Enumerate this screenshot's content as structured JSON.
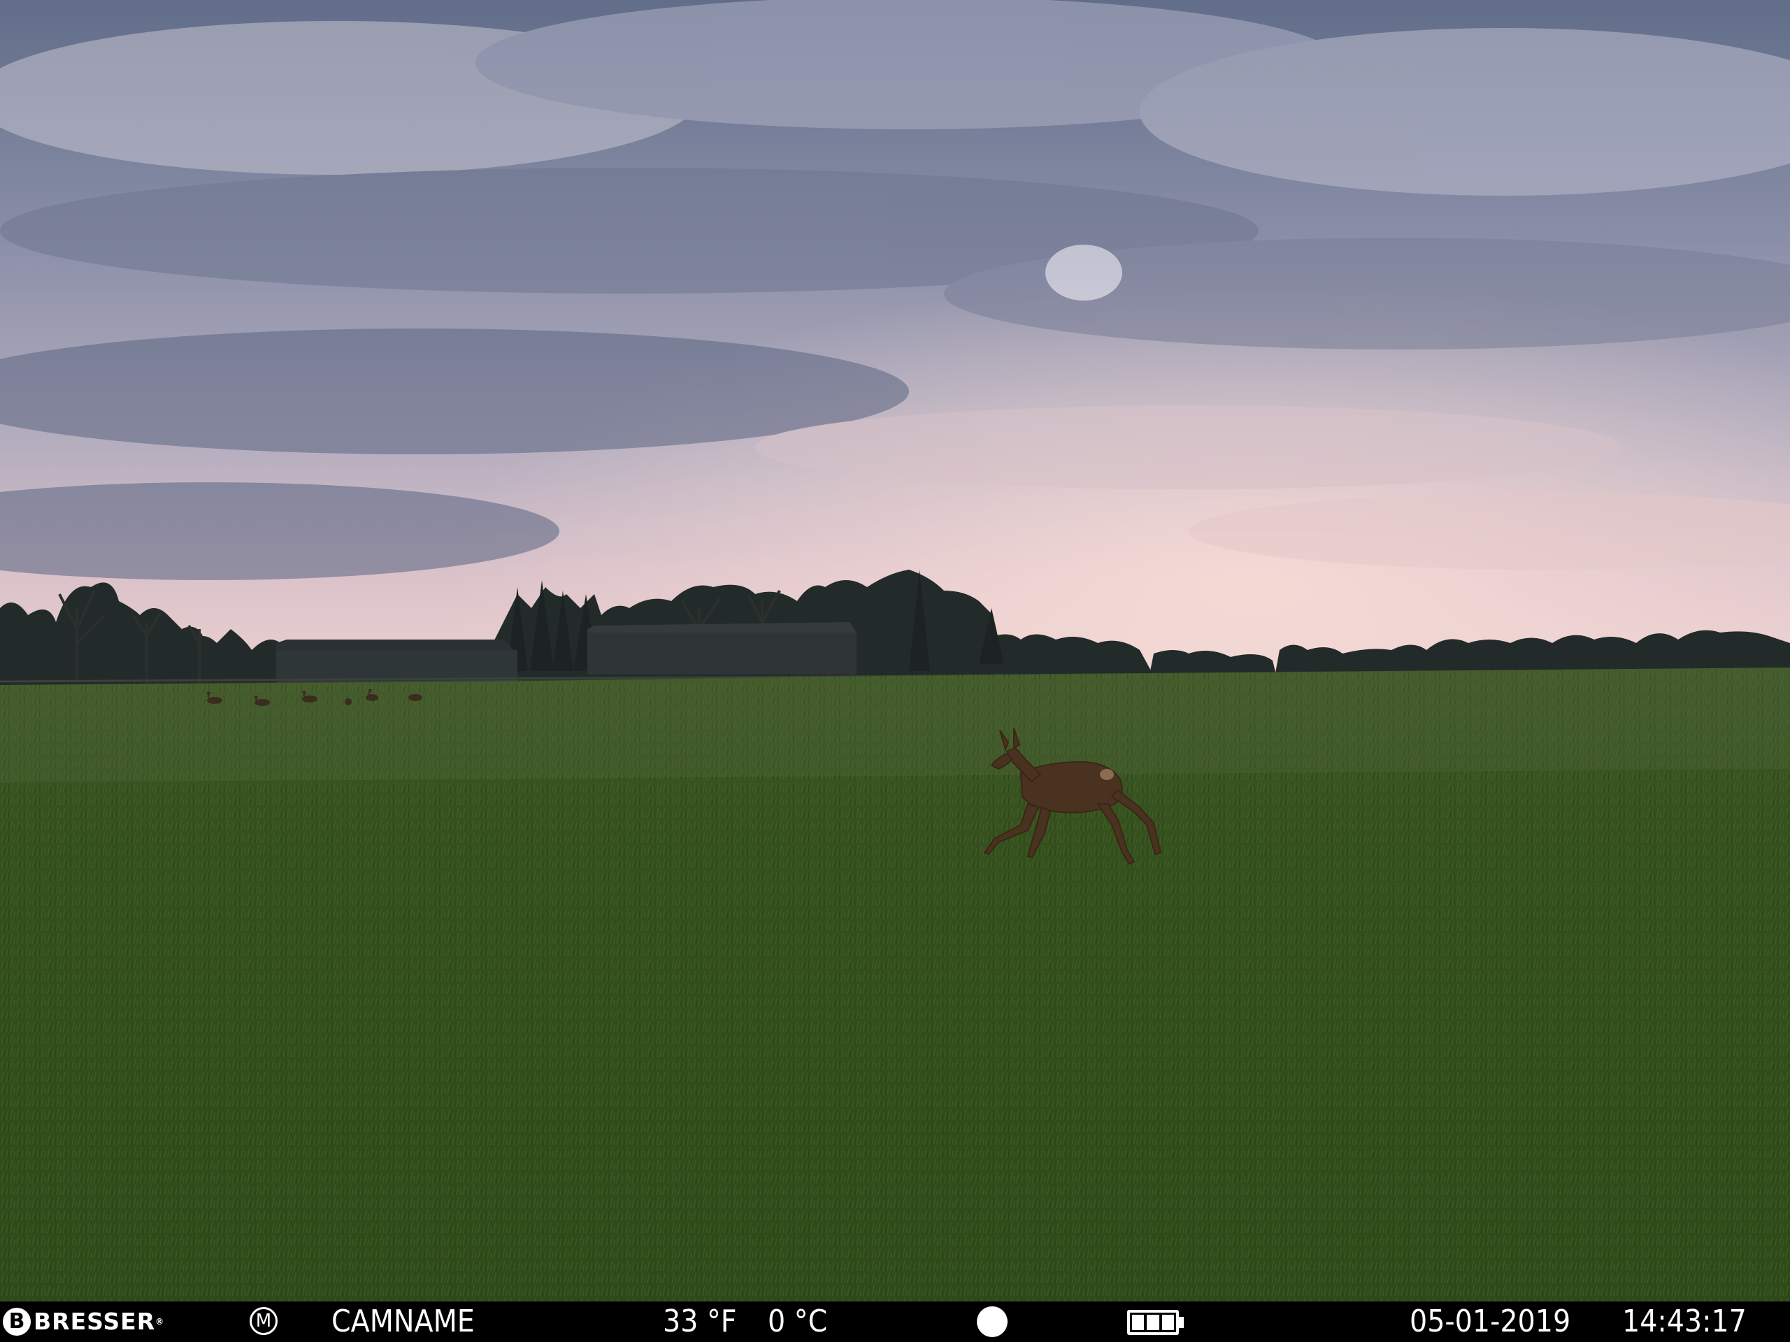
{
  "scene": {
    "description_colors": {
      "sky_top": "#5f6c88",
      "sky_horizon": "#e8c9cc",
      "grass": "#35521c"
    }
  },
  "info_bar": {
    "brand": "BRESSER",
    "brand_mark": "B",
    "registered_mark": "®",
    "mode_badge": "M",
    "camera_name": "CAMNAME",
    "temp_f_value": "33",
    "temp_f_unit": "°F",
    "temp_c_value": "0",
    "temp_c_unit": "°C",
    "record_icon": "dot-icon",
    "battery_icon": "battery-icon",
    "battery_level": 1.0,
    "date": "05-01-2019",
    "time": "14:43:17"
  }
}
